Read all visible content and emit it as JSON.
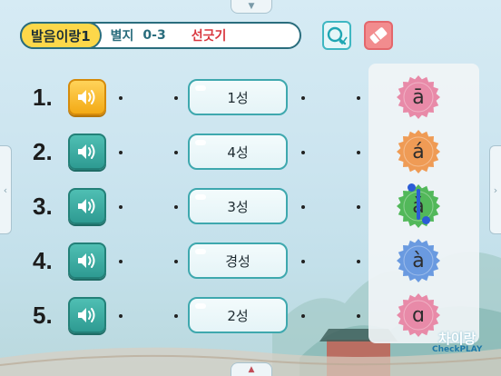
{
  "header": {
    "title": "발음이랑1",
    "subtitle": "별지",
    "code": "0-3",
    "mode": "선긋기"
  },
  "toolbar": {
    "check_icon": "check-magnifier-icon",
    "eraser_icon": "eraser-icon"
  },
  "rows": [
    {
      "number": "1.",
      "tone": "1성",
      "pinyin": "ā",
      "color": "#e88aa8",
      "active": true
    },
    {
      "number": "2.",
      "tone": "4성",
      "pinyin": "á",
      "color": "#ef9b55",
      "active": false
    },
    {
      "number": "3.",
      "tone": "3성",
      "pinyin": "ǎ",
      "color": "#52b85a",
      "active": false
    },
    {
      "number": "4.",
      "tone": "경성",
      "pinyin": "à",
      "color": "#6a9ae0",
      "active": false
    },
    {
      "number": "5.",
      "tone": "2성",
      "pinyin": "ɑ",
      "color": "#e88aa8",
      "active": false
    }
  ],
  "brand": {
    "korean": "차이랑",
    "check": "Check",
    "play": "PLAY"
  },
  "nav": {
    "up": "▼",
    "down": "▲",
    "left": "‹",
    "right": "›"
  }
}
